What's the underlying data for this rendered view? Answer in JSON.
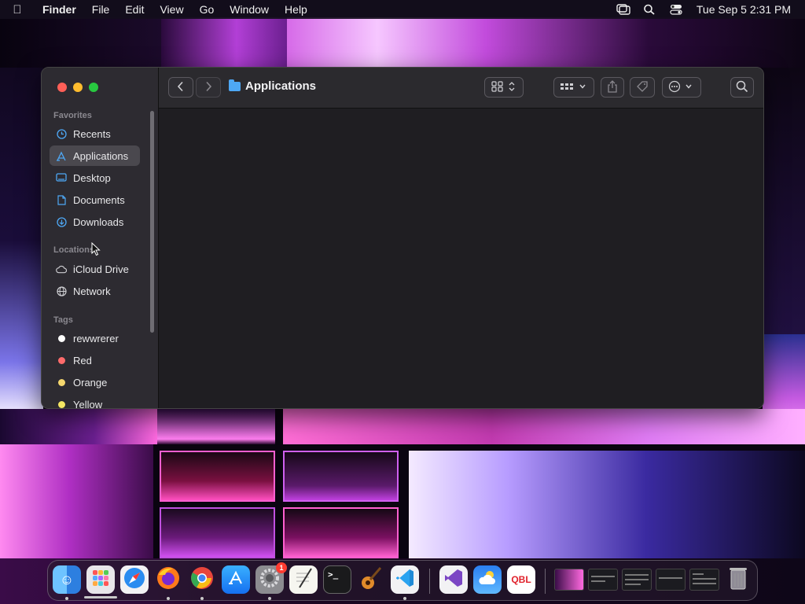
{
  "menubar": {
    "app_name": "Finder",
    "menus": [
      "File",
      "Edit",
      "View",
      "Go",
      "Window",
      "Help"
    ],
    "clock": "Tue Sep 5  2:31 PM"
  },
  "window": {
    "title": "Applications"
  },
  "sidebar": {
    "favorites_label": "Favorites",
    "favorites": [
      "Recents",
      "Applications",
      "Desktop",
      "Documents",
      "Downloads"
    ],
    "locations_label": "Locations",
    "locations": [
      "iCloud Drive",
      "Network"
    ],
    "tags_label": "Tags",
    "tags": [
      {
        "name": "rewwrerer",
        "color": "#ffffff"
      },
      {
        "name": "Red",
        "color": "#ff6b6b"
      },
      {
        "name": "Orange",
        "color": "#f5d76e"
      },
      {
        "name": "Yellow",
        "color": "#f5e663"
      }
    ]
  },
  "dock": {
    "apps": [
      "Finder",
      "Launchpad",
      "Safari",
      "Firefox",
      "Chrome",
      "App Store",
      "System Settings",
      "TextEdit",
      "Terminal",
      "GarageBand",
      "VS Code",
      "Visual Studio",
      "Weather",
      "QBL"
    ],
    "settings_badge": "1",
    "qbl_label": "QBL"
  },
  "colors": {
    "accent": "#4ea8f5",
    "close": "#ff5f57",
    "minimize": "#febc2e",
    "maximize": "#28c840"
  }
}
